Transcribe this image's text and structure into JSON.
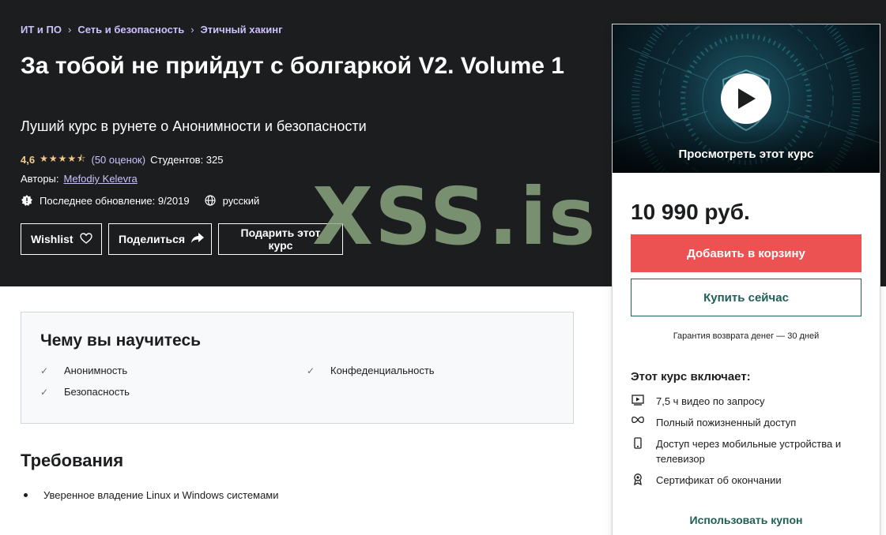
{
  "breadcrumb": [
    "ИТ и ПО",
    "Сеть и безопасность",
    "Этичный хакинг"
  ],
  "course": {
    "title": "За тобой не прийдут с болгаркой V2. Volume 1",
    "subtitle": "Луший курс в рунете о Анонимности и безопасности",
    "rating": "4,6",
    "rating_stars": 4.6,
    "rating_count": "(50 оценок)",
    "students": "Студентов: 325",
    "authors_label": "Авторы:",
    "author": "Mefodiy Kelevra",
    "last_update": "Последнее обновление: 9/2019",
    "language": "русский"
  },
  "hero_buttons": {
    "wishlist": "Wishlist",
    "share": "Поделиться",
    "gift": "Подарить этот курс"
  },
  "watermark": "XSS.is",
  "learn": {
    "title": "Чему вы научитесь",
    "items": [
      "Анонимность",
      "Конфеденциальность",
      "Безопасность"
    ]
  },
  "requirements": {
    "title": "Требования",
    "items": [
      "Уверенное владение Linux и Windows системами"
    ]
  },
  "sidebar": {
    "preview_label": "Просмотреть этот курс",
    "price": "10 990 руб.",
    "add_to_cart": "Добавить в корзину",
    "buy_now": "Купить сейчас",
    "guarantee": "Гарантия возврата денег — 30 дней",
    "includes_title": "Этот курс включает:",
    "includes": [
      {
        "icon": "video-icon",
        "text": "7,5 ч видео по запросу"
      },
      {
        "icon": "infinity-icon",
        "text": "Полный пожизненный доступ"
      },
      {
        "icon": "mobile-icon",
        "text": "Доступ через мобильные устройства и телевизор"
      },
      {
        "icon": "certificate-icon",
        "text": "Сертификат об окончании"
      }
    ],
    "coupon": "Использовать купон"
  },
  "colors": {
    "hero_bg": "#1c1d1f",
    "link_purple": "#cec0fc",
    "star": "#f3ca8c",
    "cart_red": "#ec5252",
    "teal": "#1e6055"
  }
}
